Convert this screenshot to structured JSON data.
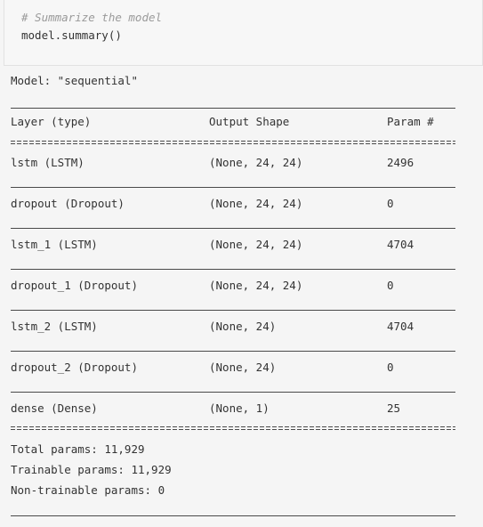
{
  "code_cell": {
    "comment": "# Summarize the model",
    "code": "model.summary()"
  },
  "summary": {
    "model_label": "Model: \"sequential\"",
    "headers": {
      "layer": "Layer (type)",
      "output_shape": "Output Shape",
      "params": "Param #"
    },
    "rows": [
      {
        "layer": "lstm (LSTM)",
        "output_shape": "(None, 24, 24)",
        "params": "2496"
      },
      {
        "layer": "dropout (Dropout)",
        "output_shape": "(None, 24, 24)",
        "params": "0"
      },
      {
        "layer": "lstm_1 (LSTM)",
        "output_shape": "(None, 24, 24)",
        "params": "4704"
      },
      {
        "layer": "dropout_1 (Dropout)",
        "output_shape": "(None, 24, 24)",
        "params": "0"
      },
      {
        "layer": "lstm_2 (LSTM)",
        "output_shape": "(None, 24)",
        "params": "4704"
      },
      {
        "layer": "dropout_2 (Dropout)",
        "output_shape": "(None, 24)",
        "params": "0"
      },
      {
        "layer": "dense (Dense)",
        "output_shape": "(None, 1)",
        "params": "25"
      }
    ],
    "total_params": "Total params: 11,929",
    "trainable_params": "Trainable params: 11,929",
    "non_trainable_params": "Non-trainable params: 0"
  },
  "colors": {
    "background": "#f5f5f5",
    "text": "#333333",
    "comment": "#9a9a9a"
  }
}
